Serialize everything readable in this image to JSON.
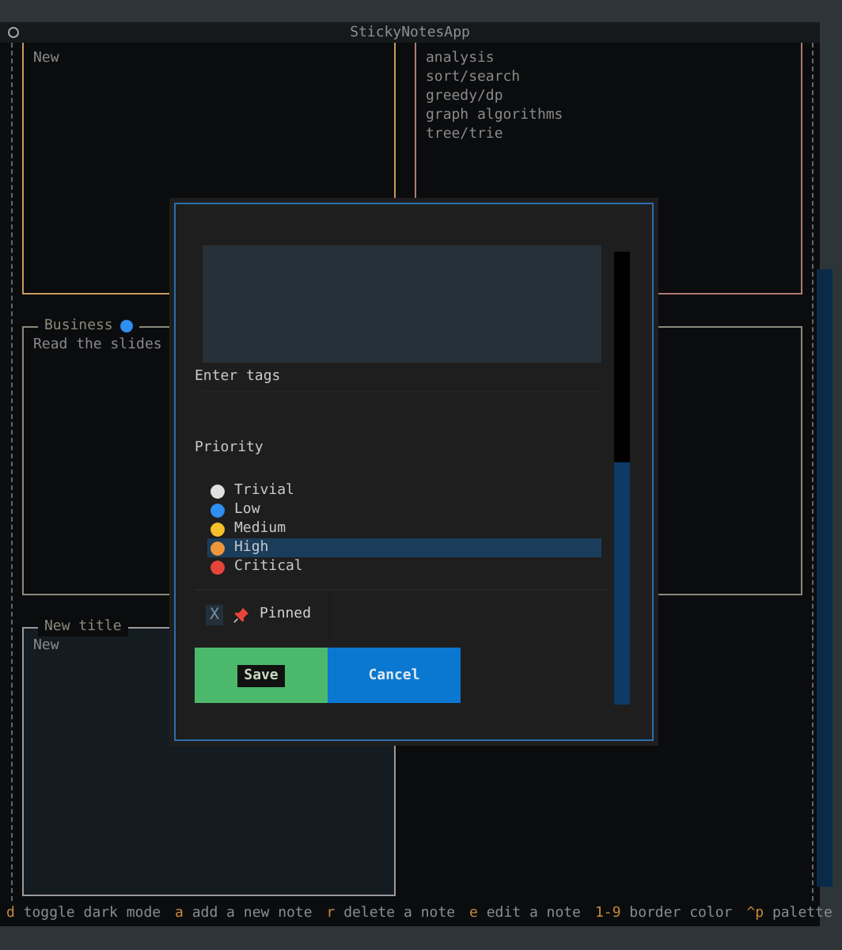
{
  "window": {
    "title": "StickyNotesApp"
  },
  "notes": [
    {
      "body": [
        "New"
      ],
      "color": "#c89a5a",
      "focused": false
    },
    {
      "body": [
        "analysis",
        "sort/search",
        "greedy/dp",
        "graph algorithms",
        "tree/trie"
      ],
      "color": "#b07a78",
      "focused": false
    },
    {
      "title": "Business",
      "dot": {
        "color": "#2f8ef0"
      },
      "body": [
        "Read the slides"
      ],
      "color": "#8a8a7a",
      "focused": false
    },
    {
      "color": "#8a8a7a",
      "focused": false
    },
    {
      "title": "New title",
      "body": [
        "New"
      ],
      "color": "#9a9a9a",
      "focused": true
    }
  ],
  "dialog": {
    "tags": {
      "label": "Enter tags"
    },
    "priority": {
      "label": "Priority",
      "options": [
        {
          "label": "Trivial",
          "color": "#e0e0e0",
          "selected": false
        },
        {
          "label": "Low",
          "color": "#2f8ef0",
          "selected": false
        },
        {
          "label": "Medium",
          "color": "#f5c02a",
          "selected": false
        },
        {
          "label": "High",
          "color": "#f0963a",
          "selected": true
        },
        {
          "label": "Critical",
          "color": "#e8453a",
          "selected": false
        }
      ]
    },
    "pinned": {
      "mark": "X",
      "label": "Pinned",
      "checked": false
    },
    "buttons": [
      {
        "label": "Save",
        "kind": "primary",
        "focused": true
      },
      {
        "label": "Cancel",
        "kind": "secondary",
        "focused": false
      }
    ]
  },
  "footer": [
    {
      "key": "d",
      "action": "toggle dark mode"
    },
    {
      "key": "a",
      "action": "add a new note"
    },
    {
      "key": "r",
      "action": "delete a note"
    },
    {
      "key": "e",
      "action": "edit a note"
    },
    {
      "key": "1-9",
      "action": "border color"
    },
    {
      "key": "^p",
      "action": "palette"
    }
  ]
}
